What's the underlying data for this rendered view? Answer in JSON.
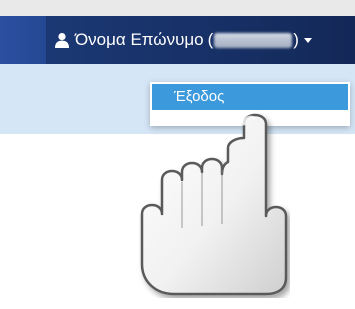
{
  "header": {
    "user_name": "Όνομα Επώνυμο",
    "open_paren": "(",
    "close_paren": ")",
    "user_icon": "user-icon",
    "caret_icon": "caret-down-icon"
  },
  "dropdown": {
    "items": [
      {
        "label": "Έξοδος"
      }
    ]
  },
  "overlay": {
    "icon": "pointing-hand-icon"
  },
  "colors": {
    "navbar": "#173066",
    "navbar_left": "#2c50a0",
    "subbar": "#d5e6f7",
    "menu_highlight": "#3b99dc",
    "text_light": "#ffffff"
  }
}
